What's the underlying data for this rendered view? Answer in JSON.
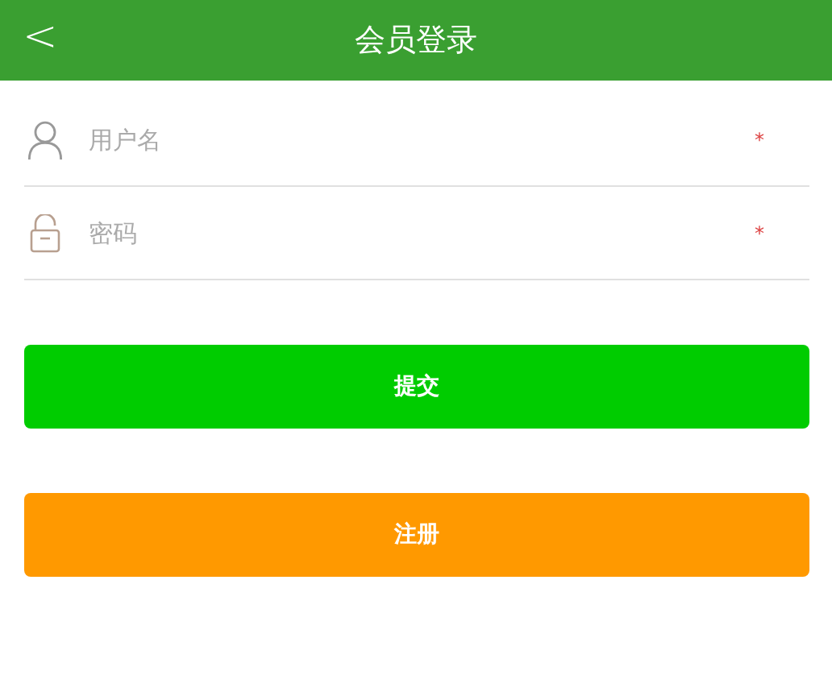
{
  "header": {
    "back": "<",
    "title": "会员登录"
  },
  "fields": [
    {
      "kind": "user",
      "placeholder": "用户名",
      "required": "*"
    },
    {
      "kind": "lock",
      "placeholder": "密码",
      "required": "*"
    }
  ],
  "buttons": [
    {
      "label": "提交",
      "color": "#00cc00"
    },
    {
      "label": "注册",
      "color": "#ff9900"
    }
  ]
}
